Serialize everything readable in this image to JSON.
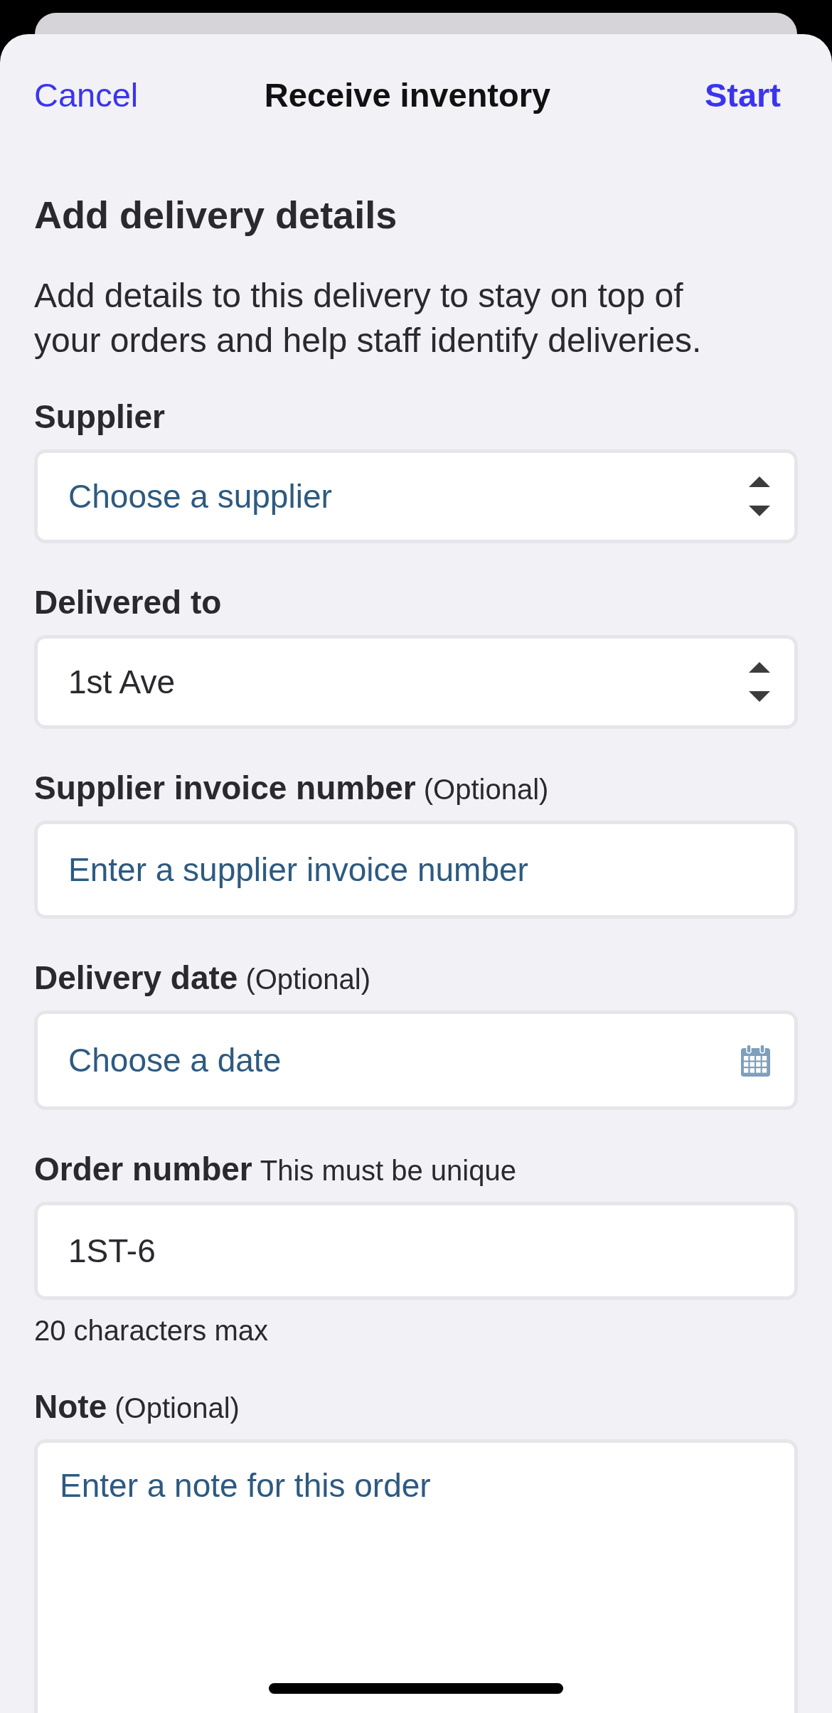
{
  "nav": {
    "cancel": "Cancel",
    "title": "Receive inventory",
    "start": "Start"
  },
  "intro": {
    "title": "Add delivery details",
    "description": "Add details to this delivery to stay on top of your orders and help staff identify deliveries."
  },
  "fields": [
    {
      "kind": "select",
      "label": "Supplier",
      "placeholder": "Choose a supplier"
    },
    {
      "kind": "select",
      "label": "Delivered to",
      "value": "1st Ave"
    },
    {
      "kind": "text",
      "label": "Supplier invoice number",
      "hint": "(Optional)",
      "placeholder": "Enter a supplier invoice number"
    },
    {
      "kind": "date",
      "label": "Delivery date",
      "hint": "(Optional)",
      "placeholder": "Choose a date"
    },
    {
      "kind": "text",
      "label": "Order number",
      "hint": "This must be unique",
      "value": "1ST-6",
      "help": "20 characters max"
    },
    {
      "kind": "textarea",
      "label": "Note",
      "hint": "(Optional)",
      "placeholder": "Enter a note for this order"
    }
  ]
}
